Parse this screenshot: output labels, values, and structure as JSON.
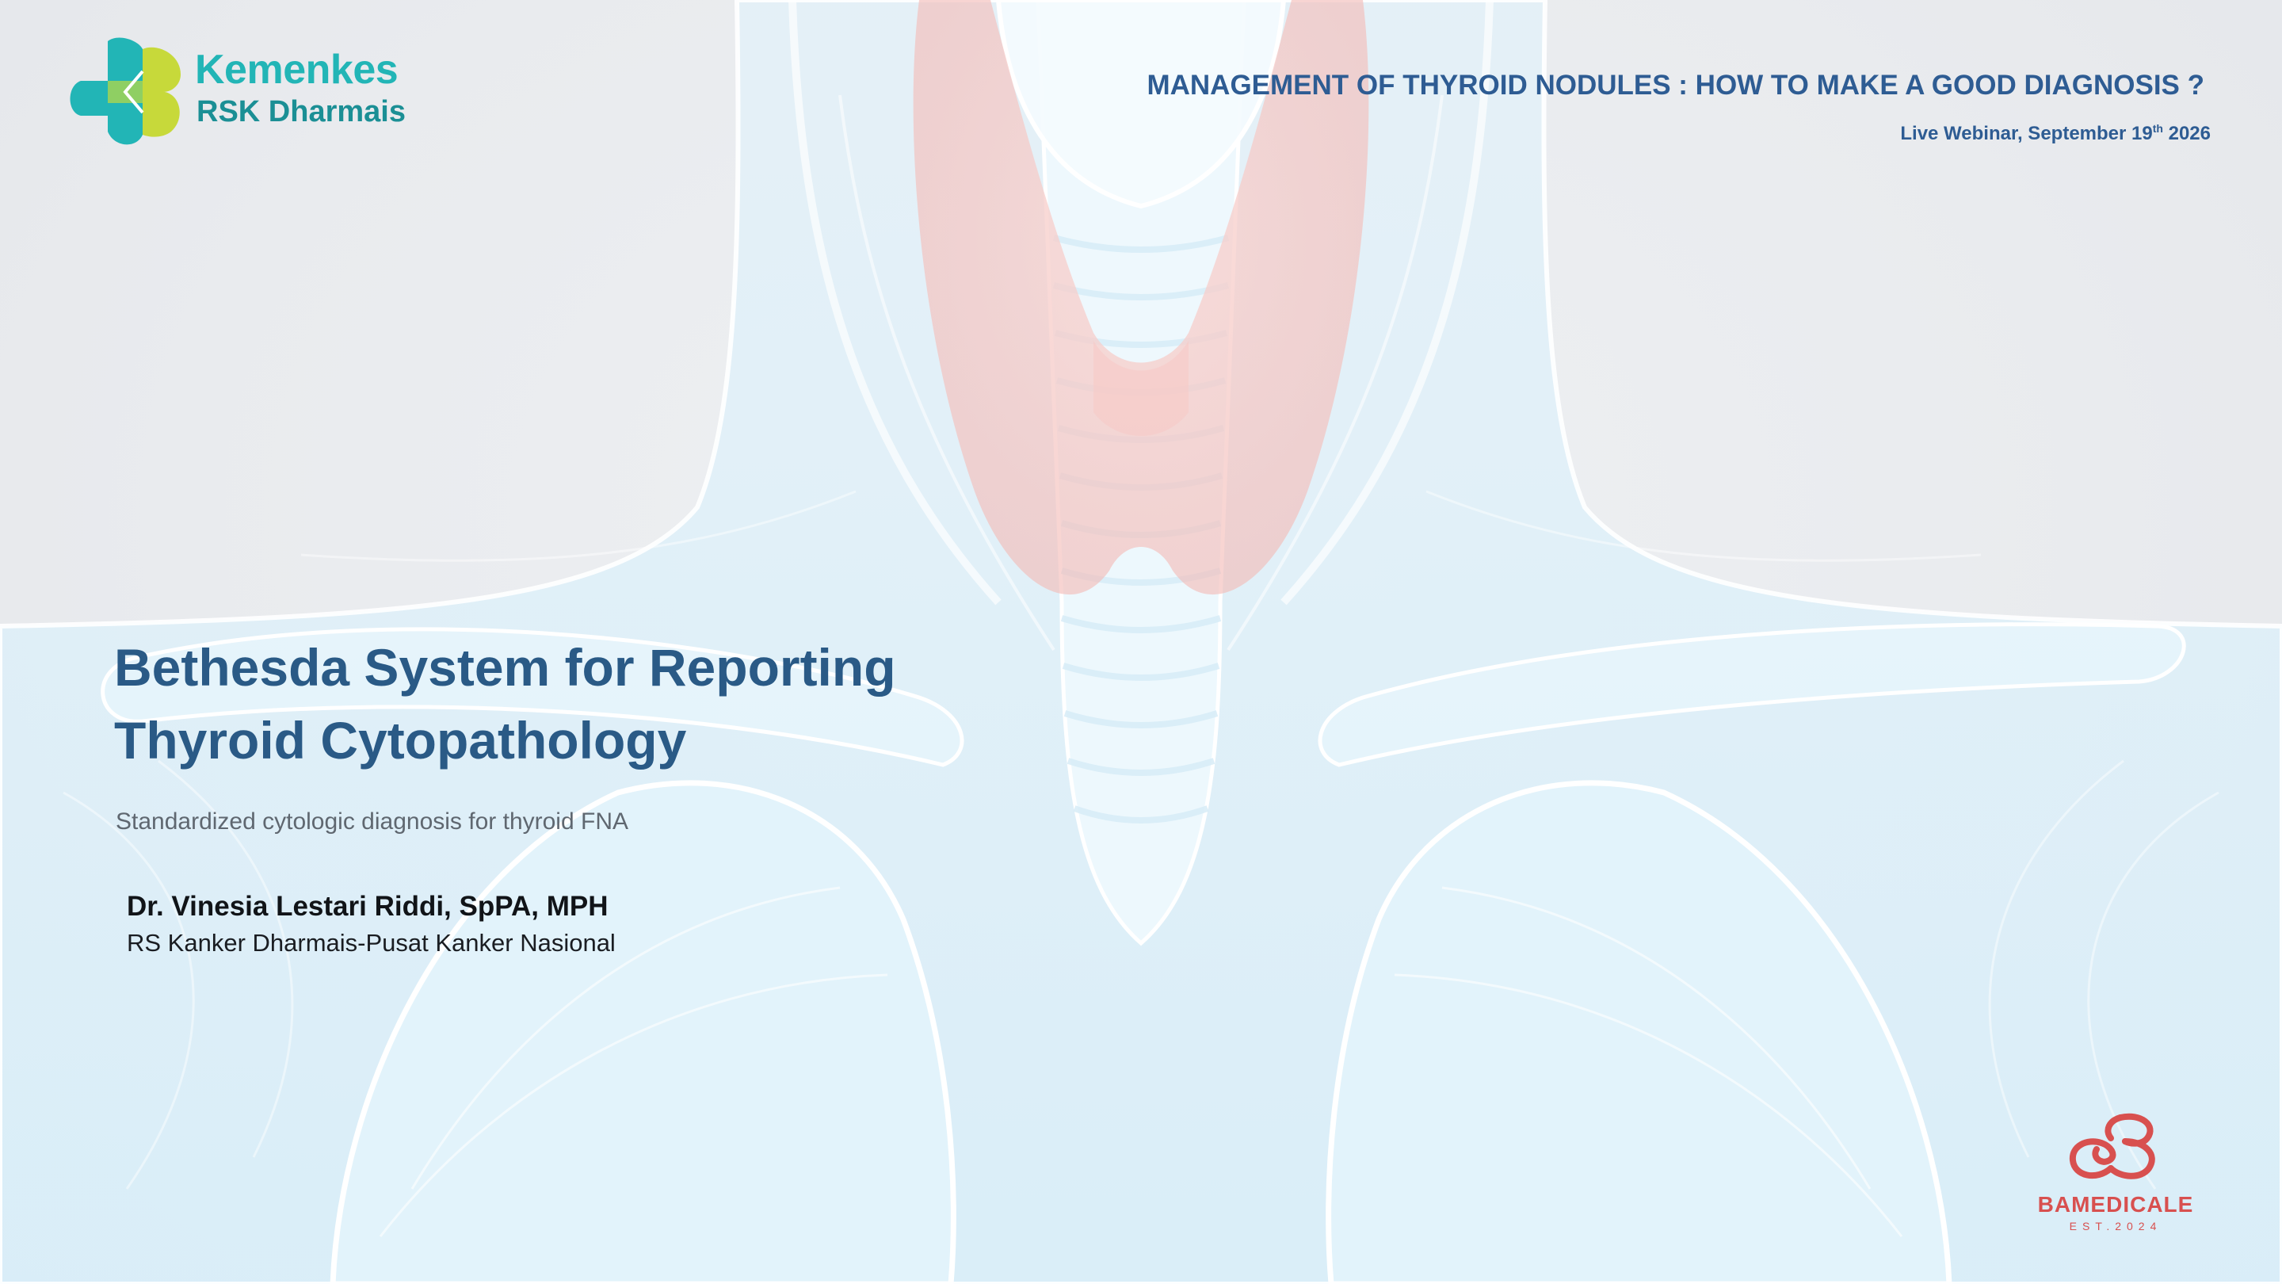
{
  "logo": {
    "line1": "Kemenkes",
    "line2": "RSK Dharmais",
    "icon": "kemenkes-clover-logo",
    "colors": {
      "teal": "#22b5b6",
      "lime": "#c7d93a",
      "dark_teal": "#1b8f95"
    }
  },
  "header": {
    "event_title": "MANAGEMENT OF THYROID NODULES : HOW TO MAKE A GOOD DIAGNOSIS ?",
    "date_prefix": "Live Webinar, September 19",
    "date_suffix": "th",
    "date_year": " 2026",
    "color": "#2e5c93"
  },
  "slide": {
    "title_line1": "Bethesda System for Reporting",
    "title_line2": "Thyroid Cytopathology",
    "subtitle": "Standardized cytologic diagnosis for thyroid FNA",
    "title_color": "#2a5a86"
  },
  "speaker": {
    "name": "Dr. Vinesia Lestari Riddi, SpPA, MPH",
    "affiliation": "RS Kanker Dharmais-Pusat Kanker Nasional"
  },
  "brand": {
    "name": "BAMEDICALE",
    "established": "EST.2024",
    "icon": "bamedicale-knot-logo",
    "color": "#d8504f"
  },
  "background": {
    "illustration": "translucent-anatomy-neck-thyroid",
    "body_color": "#d9eef8",
    "thyroid_color": "#f6c9c6"
  }
}
